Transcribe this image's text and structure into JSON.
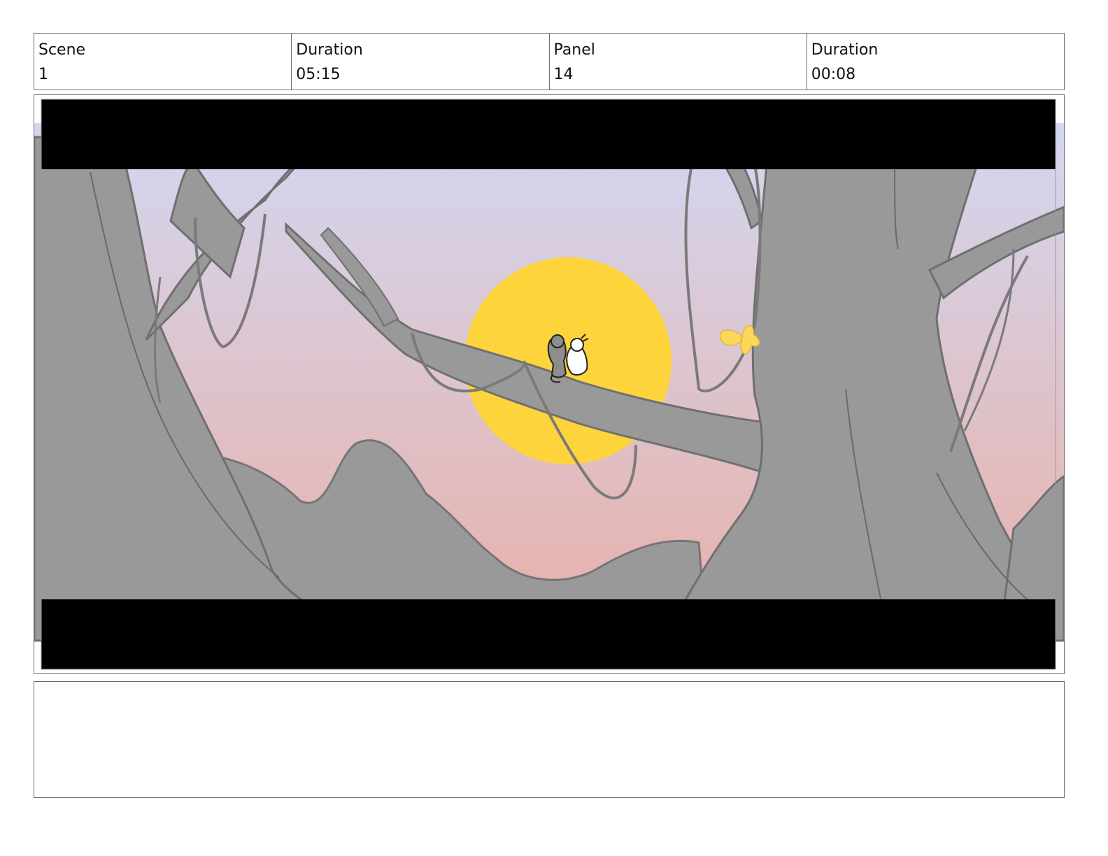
{
  "header": {
    "cells": [
      {
        "label": "Scene",
        "value": "1"
      },
      {
        "label": "Duration",
        "value": "05:15"
      },
      {
        "label": "Panel",
        "value": "14"
      },
      {
        "label": "Duration",
        "value": "00:08"
      }
    ]
  },
  "panel": {
    "colors": {
      "sky_top": "#d3d7f1",
      "sky_bottom": "#e8b0a8",
      "sun": "#fdd43b",
      "tree": "#999999",
      "tree_line": "#6f6f6f",
      "letterbox": "#000000",
      "butterfly": "#fbd75a"
    }
  },
  "notes": {
    "text": ""
  }
}
